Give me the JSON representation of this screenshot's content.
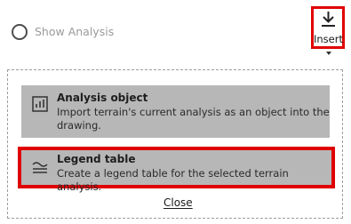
{
  "toolbar": {
    "show_analysis_label": "Show Analysis",
    "show_analysis_checked": false,
    "insert_label": "Insert"
  },
  "panel": {
    "items": [
      {
        "icon": "analysis-object-icon",
        "title": "Analysis object",
        "description_line1": "Import terrain's current analysis as an object into the",
        "description_line2": "drawing."
      },
      {
        "icon": "legend-table-icon",
        "title": "Legend table",
        "description": "Create a legend table for the selected terrain analysis."
      }
    ],
    "close_label": "Close"
  },
  "colors": {
    "highlight": "#e00000",
    "item_background": "#b7b7b7",
    "muted_text": "#9a9a9a"
  }
}
